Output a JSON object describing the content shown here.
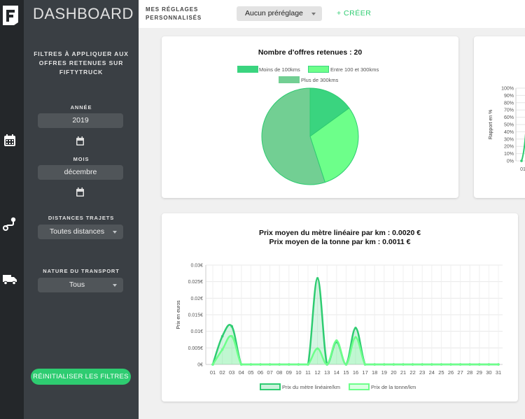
{
  "app": {
    "title": "DASHBOARD",
    "logo_icon": "fiftytruck-logo"
  },
  "rail": {
    "icons": [
      "calendar-icon",
      "route-icon",
      "truck-icon"
    ]
  },
  "sidebar": {
    "heading": "FILTRES À APPLIQUER AUX OFFRES RETENUES SUR FIFTYTRUCK",
    "year_label": "ANNÉE",
    "year_value": "2019",
    "month_label": "MOIS",
    "month_value": "décembre",
    "distance_label": "DISTANCES TRAJETS",
    "distance_value": "Toutes distances",
    "transport_label": "NATURE DU TRANSPORT",
    "transport_value": "Tous",
    "reset_label": "RÉINITIALISER LES FILTRES"
  },
  "topbar": {
    "presets_line1": "MES RÉGLAGES",
    "presets_line2": "PERSONNALISÉS",
    "preset_value": "Aucun préréglage",
    "create_label": "+ CRÉER"
  },
  "colors": {
    "accent": "#2ecc71",
    "pie_small": "#3ad47f",
    "pie_mid": "#6dff8a",
    "pie_large": "#72cf93",
    "line_metre": "#2ecc71",
    "line_tonne": "#6dff8a"
  },
  "chart_data": [
    {
      "type": "pie",
      "title": "Nombre d'offres retenues : 20",
      "labels": [
        "Moins de 100kms",
        "Entre 100 et 300kms",
        "Plus de 300kms"
      ],
      "values": [
        3,
        6,
        11
      ]
    },
    {
      "type": "line",
      "title": "",
      "ylabel": "Rapport en %",
      "y_ticks": [
        "100%",
        "90%",
        "80%",
        "70%",
        "60%",
        "50%",
        "40%",
        "30%",
        "20%",
        "10%",
        "0%"
      ],
      "x_visible": [
        "01"
      ],
      "ylim": [
        0,
        100
      ]
    },
    {
      "type": "area",
      "title_line1": "Prix moyen du mètre linéaire par km : 0.0020 €",
      "title_line2": "Prix moyen de la tonne par km : 0.0011 €",
      "xlabel": "",
      "ylabel": "Prix en euros",
      "ylim": [
        0,
        0.03
      ],
      "y_ticks": [
        "0.03€",
        "0.025€",
        "0.02€",
        "0.015€",
        "0.01€",
        "0.005€",
        "0€"
      ],
      "x": [
        "01",
        "02",
        "03",
        "04",
        "05",
        "06",
        "07",
        "08",
        "09",
        "10",
        "11",
        "12",
        "13",
        "14",
        "15",
        "16",
        "17",
        "18",
        "19",
        "20",
        "21",
        "22",
        "23",
        "24",
        "25",
        "26",
        "27",
        "28",
        "29",
        "30",
        "31"
      ],
      "series": [
        {
          "name": "Prix du mètre linéaire/km",
          "values": [
            0,
            0.0085,
            0.0115,
            0,
            0,
            0,
            0,
            0,
            0,
            0,
            0,
            0.026,
            0,
            0.0068,
            0,
            0.011,
            0,
            0,
            0,
            0,
            0,
            0,
            0,
            0,
            0,
            0,
            0,
            0,
            0,
            0,
            0
          ]
        },
        {
          "name": "Prix de la tonne/km",
          "values": [
            0,
            0.0045,
            0.0085,
            0,
            0,
            0,
            0,
            0,
            0,
            0,
            0,
            0.0048,
            0,
            0.0072,
            0,
            0.0082,
            0,
            0,
            0,
            0,
            0,
            0,
            0,
            0,
            0,
            0,
            0,
            0,
            0,
            0,
            0
          ]
        }
      ]
    }
  ]
}
